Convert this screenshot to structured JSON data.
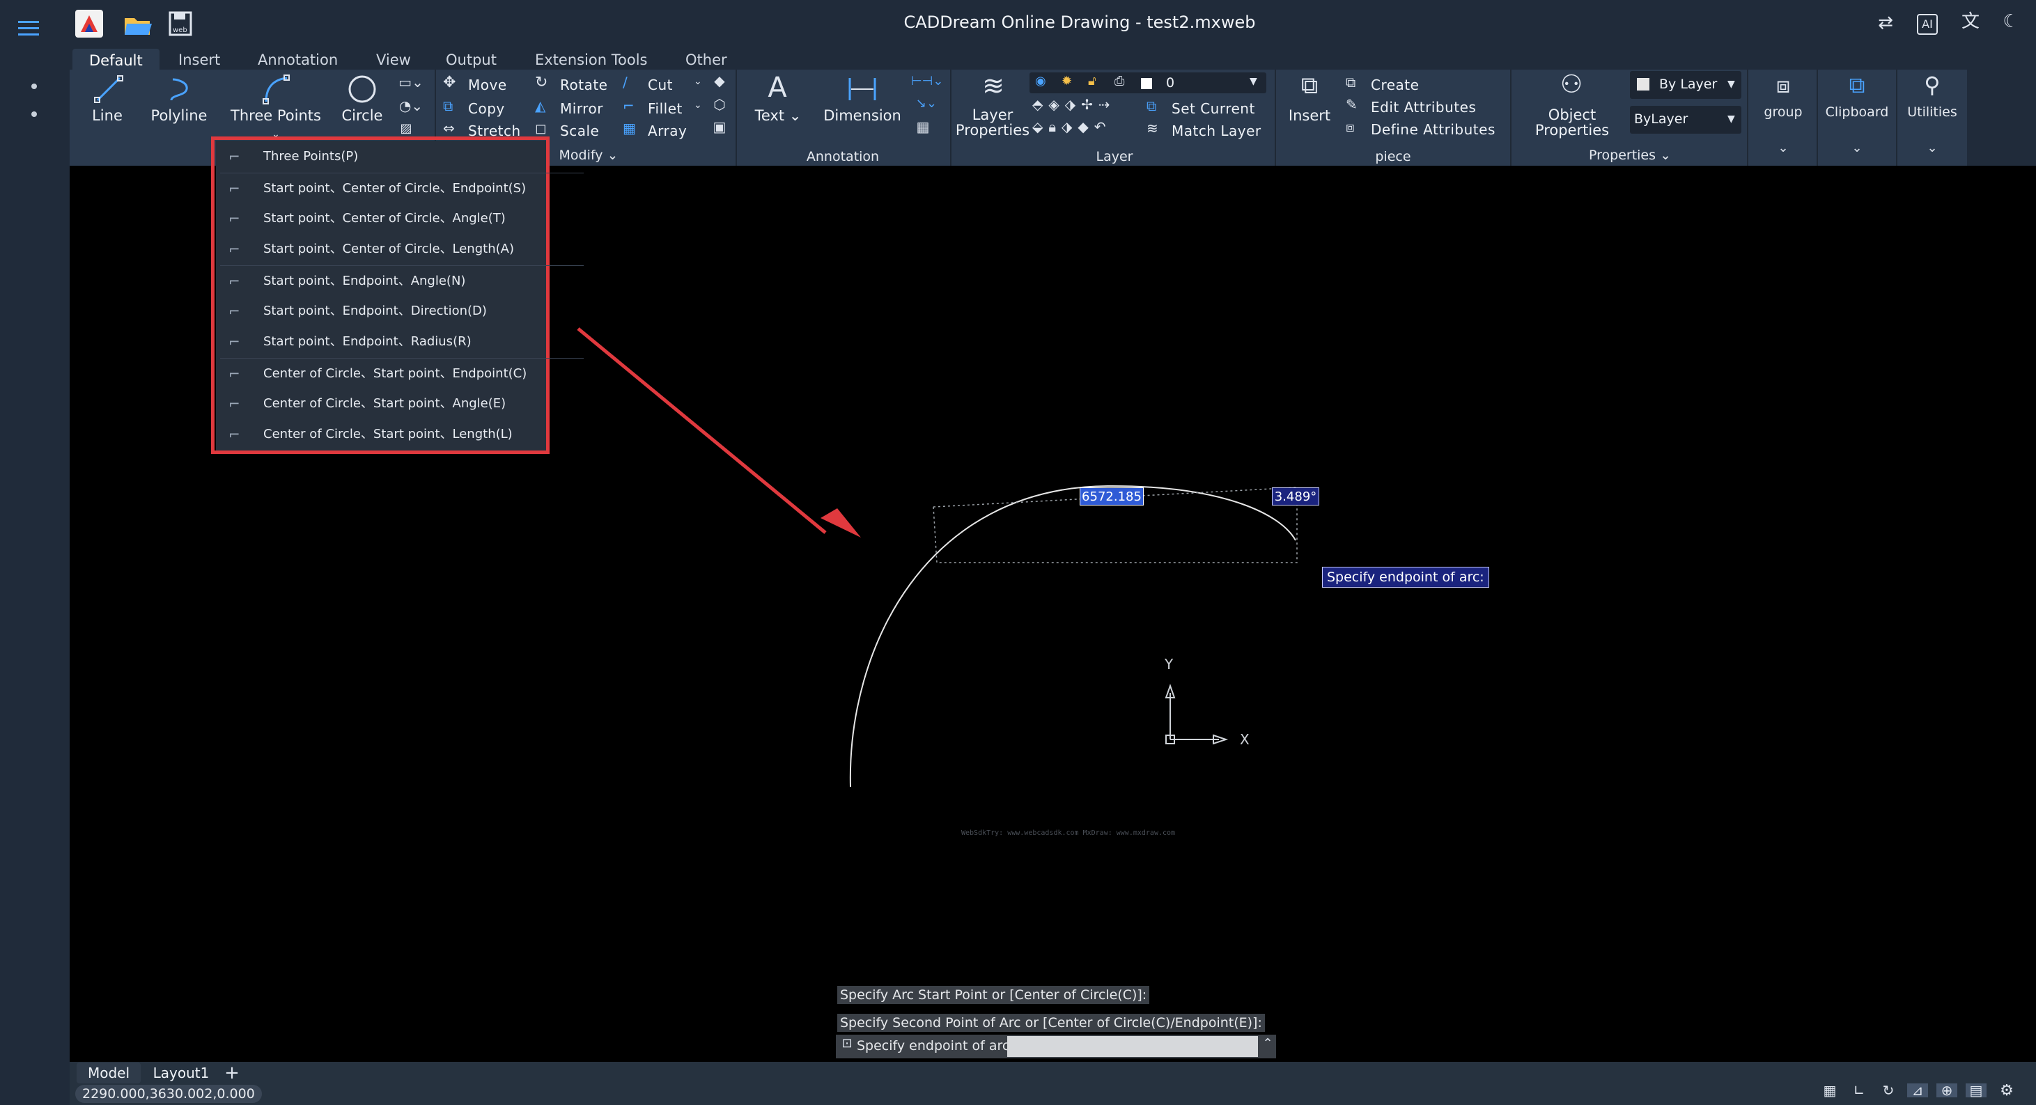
{
  "app": {
    "title": "CADDream Online Drawing - test2.mxweb"
  },
  "ribbon_tabs": [
    "Default",
    "Insert",
    "Annotation",
    "View",
    "Output",
    "Extension Tools",
    "Other"
  ],
  "draw_group": {
    "line": "Line",
    "polyline": "Polyline",
    "three_points": "Three Points",
    "circle": "Circle"
  },
  "modify_group": {
    "move": "Move",
    "copy": "Copy",
    "stretch": "Stretch",
    "rotate": "Rotate",
    "mirror": "Mirror",
    "scale": "Scale",
    "cut": "Cut",
    "fillet": "Fillet",
    "array": "Array",
    "label": "Modify"
  },
  "annotation_group": {
    "text": "Text",
    "dimension": "Dimension",
    "label": "Annotation"
  },
  "layer_group": {
    "layer_properties": "Layer Properties",
    "current_layer": "0",
    "set_current": "Set Current",
    "match_layer": "Match Layer",
    "label": "Layer"
  },
  "piece_group": {
    "insert": "Insert",
    "create": "Create",
    "edit_attributes": "Edit Attributes",
    "define_attributes": "Define Attributes",
    "label": "piece"
  },
  "properties_group": {
    "object_properties": "Object Properties",
    "color_value": "By Layer",
    "linetype_value": "ByLayer",
    "label": "Properties"
  },
  "extra_groups": {
    "group": "group",
    "clipboard": "Clipboard",
    "utilities": "Utilities"
  },
  "arc_menu": [
    "Three Points(P)",
    "Start point、Center of Circle、Endpoint(S)",
    "Start point、Center of Circle、Angle(T)",
    "Start point、Center of Circle、Length(A)",
    "Start point、Endpoint、Angle(N)",
    "Start point、Endpoint、Direction(D)",
    "Start point、Endpoint、Radius(R)",
    "Center of Circle、Start point、Endpoint(C)",
    "Center of Circle、Start point、Angle(E)",
    "Center of Circle、Start point、Length(L)"
  ],
  "drawing": {
    "length_input": "6572.185",
    "angle_input": "3.489°",
    "tooltip": "Specify endpoint of arc:",
    "watermark": "WebSdkTry: www.webcadsdk.com MxDraw: www.mxdraw.com",
    "ucs_x": "X",
    "ucs_y": "Y"
  },
  "command_history": [
    "Specify Arc Start Point or [Center of Circle(C)]:",
    "Specify Second Point of Arc or [Center of Circle(C)/Endpoint(E)]:"
  ],
  "command_prompt": "Specify endpoint of arc:",
  "command_input_value": "",
  "layout_tabs": [
    "Model",
    "Layout1"
  ],
  "add_tab": "+",
  "coordinates": "2290.000,3630.002,0.000",
  "colors": {
    "ribbon_bg": "#2b3a4e",
    "titlebar_bg": "#202b3a",
    "highlight_red": "#e0393e",
    "input_blue": "#2f5bd6",
    "tooltip_bg": "#1a237e"
  }
}
